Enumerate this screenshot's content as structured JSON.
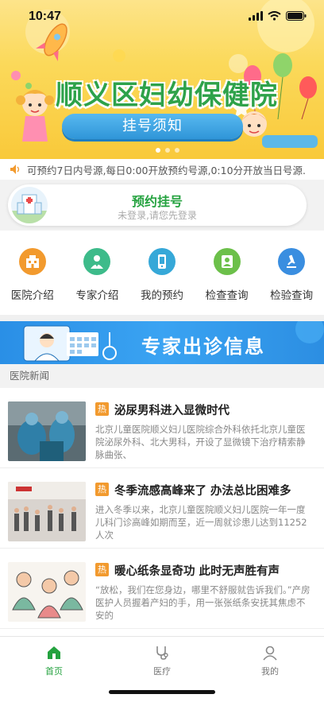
{
  "status_bar": {
    "time": "10:47"
  },
  "banner": {
    "title": "顺义区妇幼保健院",
    "button": "挂号须知",
    "slides": 3,
    "active_slide": 0
  },
  "notice": {
    "text": "可预约7日内号源,每日0:00开放预约号源,0:10分开放当日号源."
  },
  "appointment": {
    "title": "预约挂号",
    "subtitle": "未登录,请您先登录"
  },
  "menu": {
    "items": [
      {
        "label": "医院介绍",
        "icon": "hospital-icon",
        "color": "#f29a2e"
      },
      {
        "label": "专家介绍",
        "icon": "doctor-icon",
        "color": "#3dbb8a"
      },
      {
        "label": "我的预约",
        "icon": "phone-icon",
        "color": "#36a8d8"
      },
      {
        "label": "检查查询",
        "icon": "exam-user-icon",
        "color": "#6cc04a"
      },
      {
        "label": "检验查询",
        "icon": "microscope-icon",
        "color": "#3a8ee0"
      }
    ]
  },
  "expert_banner": {
    "text": "专家出诊信息"
  },
  "news": {
    "header": "医院新闻",
    "badge": "热",
    "items": [
      {
        "title": "泌尿男科进入显微时代",
        "summary": "北京儿童医院顺义妇儿医院综合外科依托北京儿童医院泌尿外科、北大男科，开设了显微镜下治疗精索静脉曲张、"
      },
      {
        "title": "冬季流感高峰来了 办法总比困难多",
        "summary": "进入冬季以来，北京儿童医院顺义妇儿医院一年一度儿科门诊高峰如期而至，近一周就诊患儿达到11252人次"
      },
      {
        "title": "暖心纸条显奇功 此时无声胜有声",
        "summary": "“放松，我们在您身边，哪里不舒服就告诉我们。”产房医护人员握着产妇的手，用一张张纸条安抚其焦虑不安的"
      }
    ]
  },
  "tabbar": {
    "items": [
      {
        "label": "首页",
        "icon": "home-icon",
        "active": true
      },
      {
        "label": "医疗",
        "icon": "stethoscope-icon",
        "active": false
      },
      {
        "label": "我的",
        "icon": "user-icon",
        "active": false
      }
    ]
  },
  "colors": {
    "accent": "#24a23f",
    "hot": "#f29a2e",
    "banner_blue": "#3aa3f2"
  }
}
